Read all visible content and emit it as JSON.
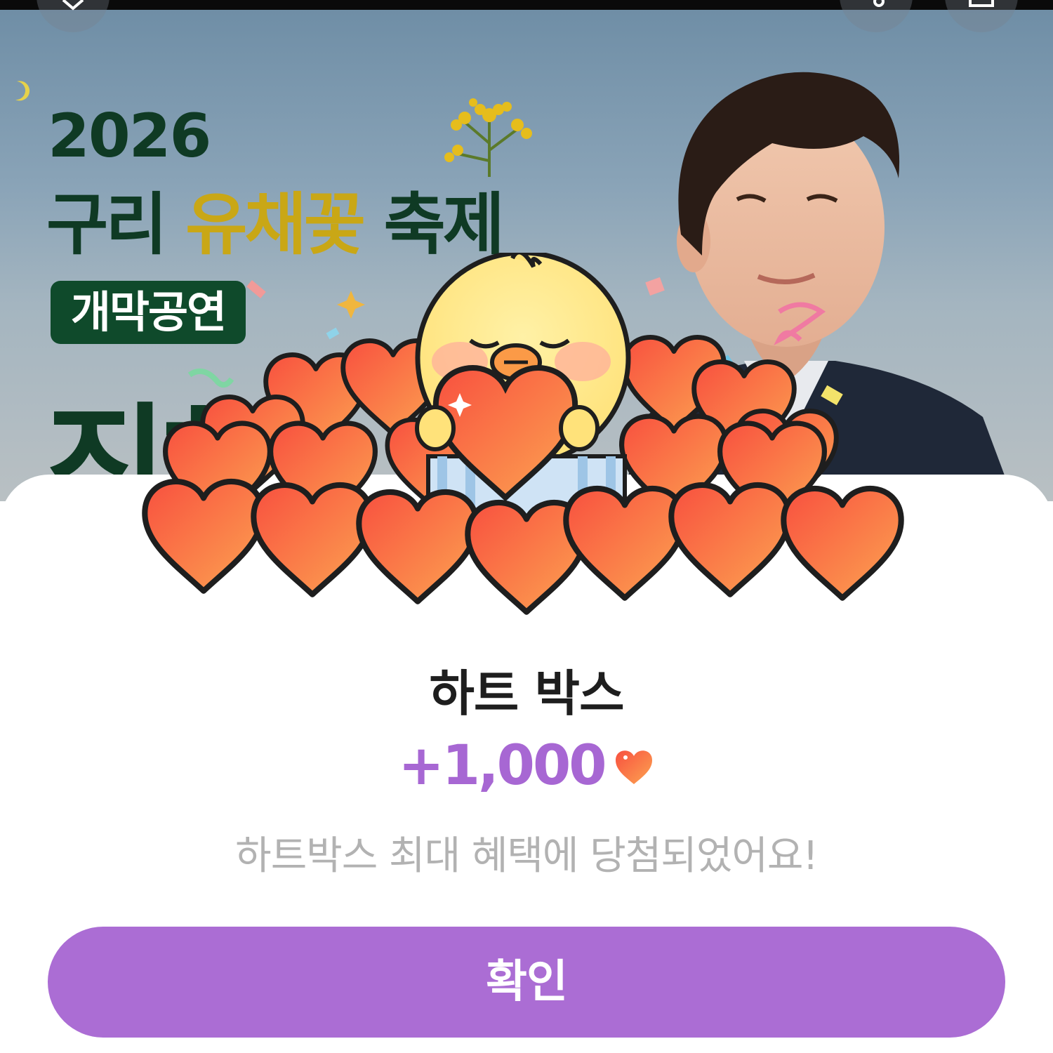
{
  "banner": {
    "year": "2026",
    "title_part1": "구리",
    "title_highlight": "유채꽃",
    "title_part2": "축제",
    "tag": "개막공연",
    "big_text": "진해"
  },
  "colors": {
    "accent": "#ab6dd4",
    "amount": "#a767d3",
    "banner_green": "#0f3a24",
    "highlight_yellow": "#c9a716"
  },
  "icons": {
    "close": "close-icon",
    "share": "share-icon",
    "download": "download-icon",
    "heart": "heart-icon",
    "mascot": "chick-mascot"
  },
  "reward": {
    "title": "하트 박스",
    "amount": "+1,000",
    "message": "하트박스 최대 혜택에 당첨되었어요!",
    "confirm_label": "확인"
  }
}
